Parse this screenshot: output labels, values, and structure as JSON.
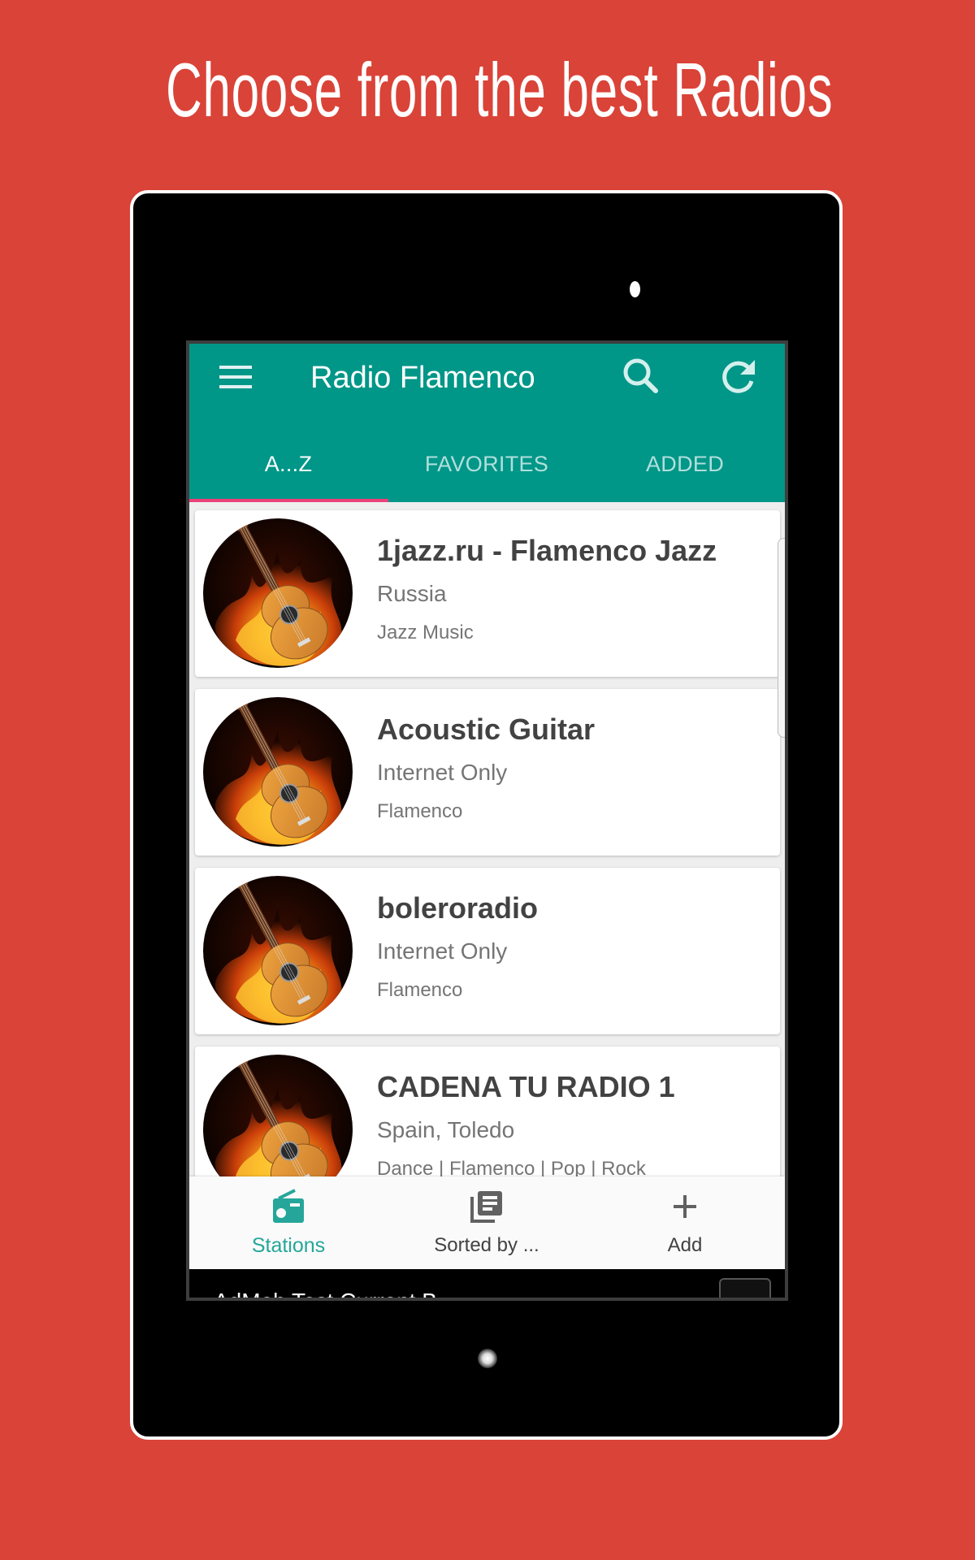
{
  "promo": {
    "headline": "Choose from the best Radios",
    "background_color": "#da4338"
  },
  "app": {
    "title": "Radio Flamenco",
    "accent_color": "#009688",
    "indicator_color": "#ec407a",
    "actions": {
      "menu_icon": "hamburger-menu-icon",
      "search_icon": "search-icon",
      "refresh_icon": "refresh-icon"
    }
  },
  "tabs": [
    {
      "label": "A...Z",
      "active": true
    },
    {
      "label": "FAVORITES",
      "active": false
    },
    {
      "label": "ADDED",
      "active": false
    }
  ],
  "stations": [
    {
      "name": "1jazz.ru - Flamenco Jazz",
      "location": "Russia",
      "genre": "Jazz Music",
      "logo": "flaming-guitar-logo"
    },
    {
      "name": "Acoustic Guitar",
      "location": "Internet Only",
      "genre": "Flamenco",
      "logo": "flaming-guitar-logo"
    },
    {
      "name": "boleroradio",
      "location": "Internet Only",
      "genre": "Flamenco",
      "logo": "flaming-guitar-logo"
    },
    {
      "name": "CADENA TU RADIO 1",
      "location": "Spain, Toledo",
      "genre": "Dance | Flamenco | Pop | Rock",
      "logo": "flaming-guitar-logo"
    }
  ],
  "bottom_nav": [
    {
      "label": "Stations",
      "icon": "radio-icon",
      "active": true
    },
    {
      "label": "Sorted by ...",
      "icon": "library-books-icon",
      "active": false
    },
    {
      "label": "Add",
      "icon": "plus-icon",
      "active": false
    }
  ],
  "ad": {
    "text": "AdMob Test Current B"
  }
}
